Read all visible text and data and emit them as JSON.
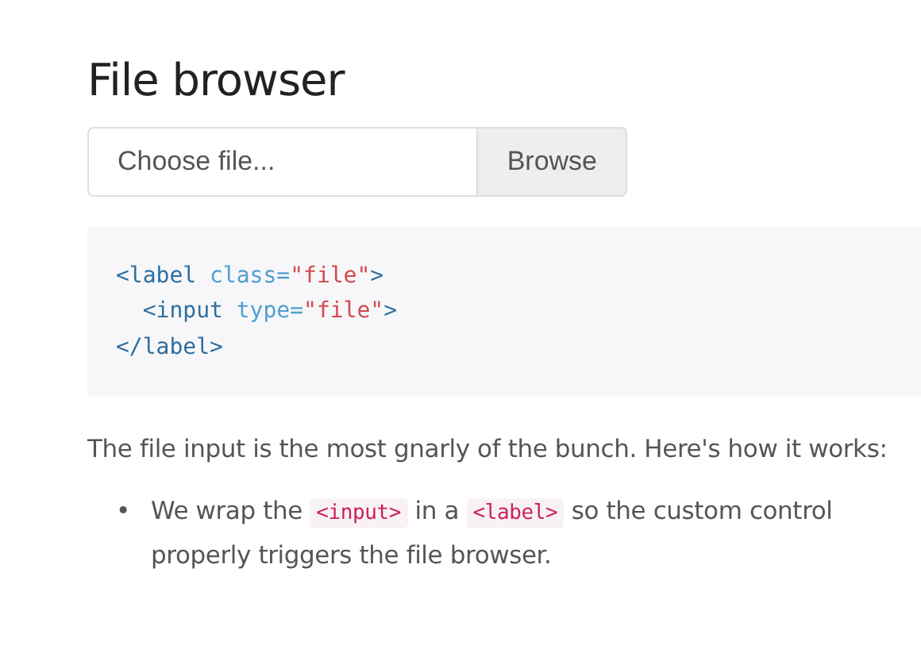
{
  "heading": "File browser",
  "file_input": {
    "placeholder": "Choose file...",
    "button": "Browse"
  },
  "code_lines": [
    [
      {
        "kind": "tag",
        "text": "<label"
      },
      {
        "kind": "attr",
        "text": " class="
      },
      {
        "kind": "value",
        "text": "\"file\""
      },
      {
        "kind": "tag",
        "text": ">"
      }
    ],
    [
      {
        "kind": "tag",
        "text": "  <input"
      },
      {
        "kind": "attr",
        "text": " type="
      },
      {
        "kind": "value",
        "text": "\"file\""
      },
      {
        "kind": "tag",
        "text": ">"
      }
    ],
    [
      {
        "kind": "tag",
        "text": "</label>"
      }
    ]
  ],
  "paragraph": "The file input is the most gnarly of the bunch. Here's how it works:",
  "bullets": [
    [
      {
        "kind": "marker",
        "text": "•"
      },
      {
        "kind": "text",
        "text": "We wrap the "
      },
      {
        "kind": "code",
        "text": "<input>"
      },
      {
        "kind": "text",
        "text": " in a "
      },
      {
        "kind": "code",
        "text": "<label>"
      },
      {
        "kind": "text",
        "text": " so the custom control properly triggers the file browser."
      }
    ]
  ]
}
